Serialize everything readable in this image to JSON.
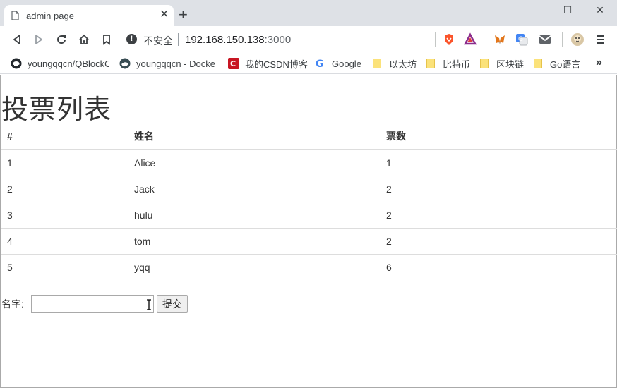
{
  "browser": {
    "tab": {
      "title": "admin page",
      "close": "✕"
    },
    "new_tab": "+",
    "window_controls": {
      "minimize": "—",
      "maximize": "☐",
      "close": "✕"
    },
    "omnibox": {
      "security_label": "不安全",
      "host": "192.168.150.138",
      "port": ":3000"
    },
    "bookmarks": [
      {
        "label": "youngqqcn/QBlockC",
        "icon": "github-icon"
      },
      {
        "label": "youngqqcn - Docke",
        "icon": "docker-icon"
      },
      {
        "label": "我的CSDN博客",
        "icon": "csdn-icon"
      },
      {
        "label": "Google",
        "icon": "google-icon"
      },
      {
        "label": "以太坊",
        "icon": "folder-icon"
      },
      {
        "label": "比特币",
        "icon": "folder-icon"
      },
      {
        "label": "区块链",
        "icon": "folder-icon"
      },
      {
        "label": "Go语言",
        "icon": "folder-icon"
      }
    ],
    "bookmarks_more": "»"
  },
  "page": {
    "title": "投票列表",
    "table": {
      "headers": [
        "#",
        "姓名",
        "票数"
      ],
      "rows": [
        [
          "1",
          "Alice",
          "1"
        ],
        [
          "2",
          "Jack",
          "2"
        ],
        [
          "3",
          "hulu",
          "2"
        ],
        [
          "4",
          "tom",
          "2"
        ],
        [
          "5",
          "yqq",
          "6"
        ]
      ]
    },
    "form": {
      "name_label": "名字:",
      "name_value": "",
      "submit_label": "提交"
    }
  }
}
